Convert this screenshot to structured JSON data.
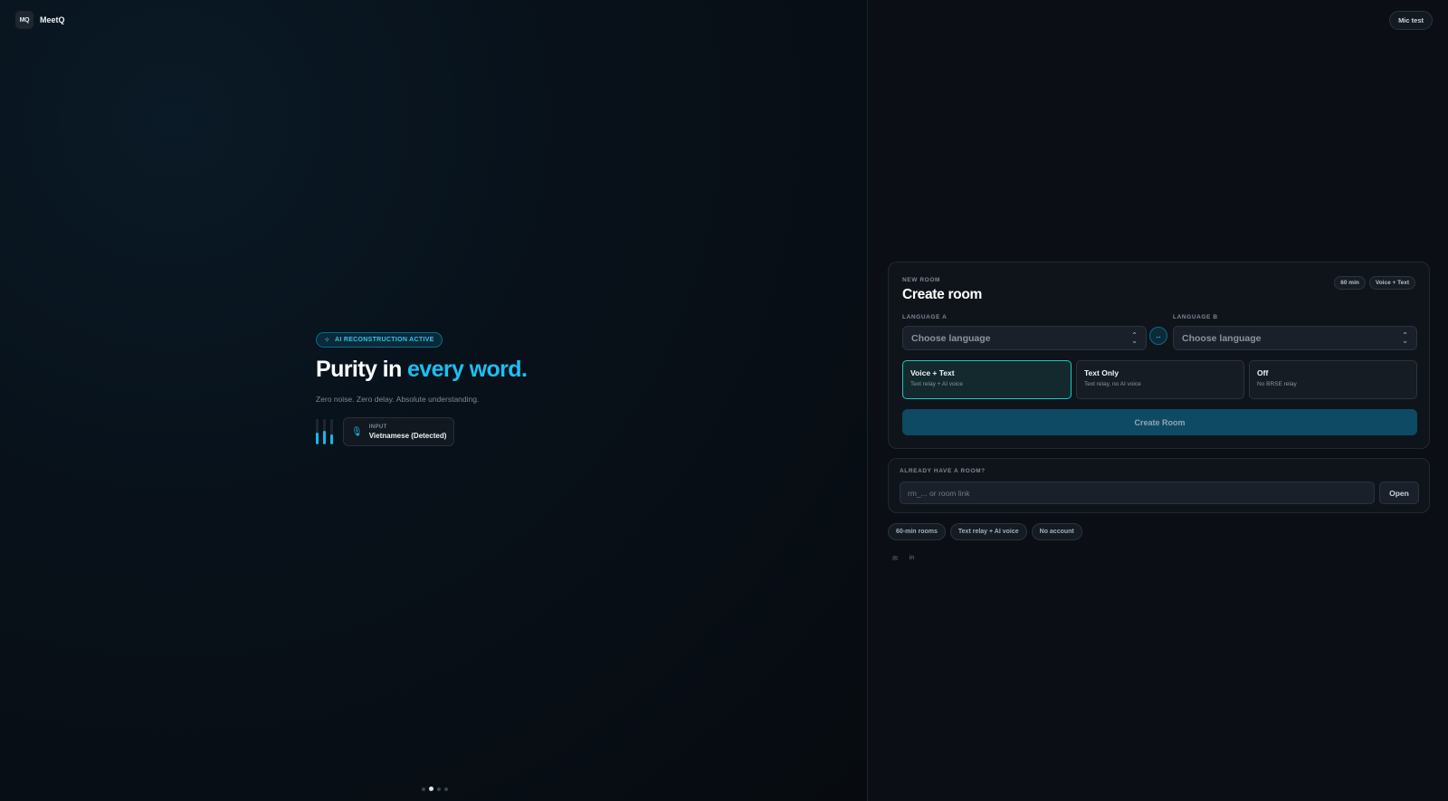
{
  "brand": {
    "logo_text": "MQ",
    "name": "MeetQ"
  },
  "hero": {
    "badge": "AI RECONSTRUCTION ACTIVE",
    "headline_plain": "Purity in ",
    "headline_accent": "every word.",
    "subtitle": "Zero noise. Zero delay. Absolute understanding.",
    "input_label": "INPUT",
    "input_value": "Vietnamese (Detected)",
    "level_bars": [
      0.45,
      0.55,
      0.4
    ]
  },
  "carousel": {
    "count": 4,
    "active_index": 1
  },
  "header": {
    "mic_test": "Mic test"
  },
  "create_room": {
    "eyebrow": "NEW ROOM",
    "title": "Create room",
    "pills": [
      "60 min",
      "Voice + Text"
    ],
    "language_a_label": "LANGUAGE A",
    "language_b_label": "LANGUAGE B",
    "language_a_value": "Choose language",
    "language_b_value": "Choose language",
    "swap_icon": "↔",
    "modes": [
      {
        "title": "Voice + Text",
        "subtitle": "Text relay + AI voice",
        "selected": true
      },
      {
        "title": "Text Only",
        "subtitle": "Text relay, no AI voice",
        "selected": false
      },
      {
        "title": "Off",
        "subtitle": "No BRSE relay",
        "selected": false
      }
    ],
    "button": "Create Room"
  },
  "join_room": {
    "eyebrow": "ALREADY HAVE A ROOM?",
    "placeholder": "rm_... or room link",
    "button": "Open"
  },
  "features": [
    "60-min rooms",
    "Text relay + AI voice",
    "No account"
  ],
  "socials": {
    "mail_icon": "✉",
    "linkedin_icon": "in"
  },
  "colors": {
    "accent": "#1cbff2",
    "selected_border": "#20c7c0",
    "button_bg": "#0e4a63"
  }
}
